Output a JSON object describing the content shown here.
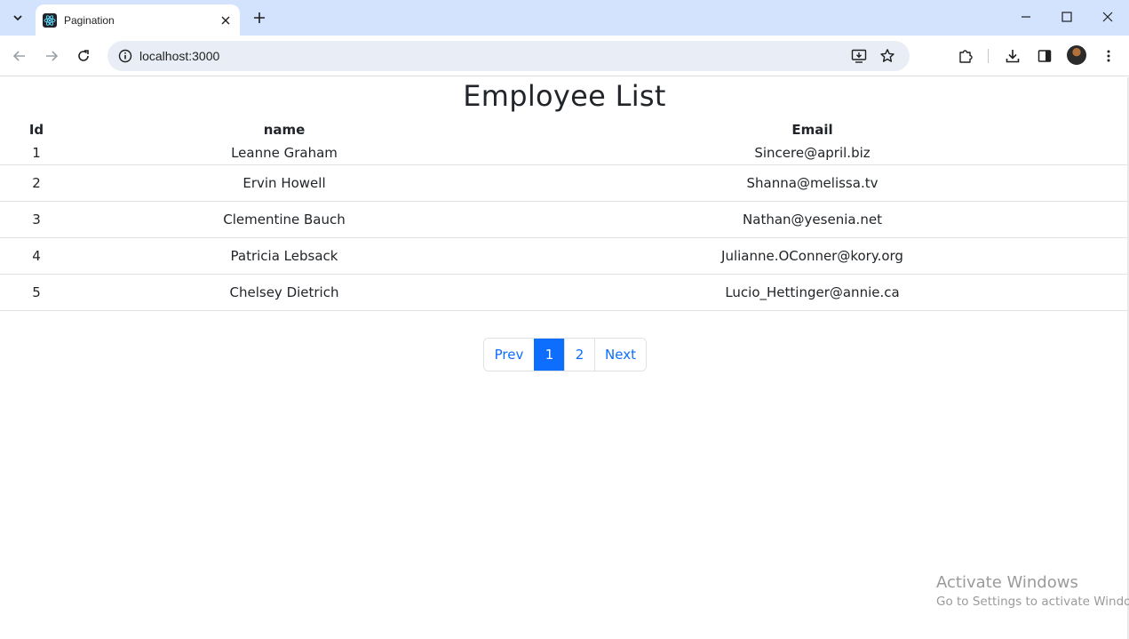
{
  "browser": {
    "tab_title": "Pagination",
    "url": "localhost:3000"
  },
  "page": {
    "title": "Employee List",
    "columns": [
      "Id",
      "name",
      "Email"
    ],
    "rows": [
      {
        "id": "1",
        "name": "Leanne Graham",
        "email": "Sincere@april.biz"
      },
      {
        "id": "2",
        "name": "Ervin Howell",
        "email": "Shanna@melissa.tv"
      },
      {
        "id": "3",
        "name": "Clementine Bauch",
        "email": "Nathan@yesenia.net"
      },
      {
        "id": "4",
        "name": "Patricia Lebsack",
        "email": "Julianne.OConner@kory.org"
      },
      {
        "id": "5",
        "name": "Chelsey Dietrich",
        "email": "Lucio_Hettinger@annie.ca"
      }
    ],
    "pagination": {
      "prev_label": "Prev",
      "pages": [
        "1",
        "2"
      ],
      "active_page": "1",
      "next_label": "Next"
    }
  },
  "watermark": {
    "title": "Activate Windows",
    "subtitle": "Go to Settings to activate Windo"
  },
  "colors": {
    "tabstrip": "#d3e3fd",
    "accent": "#0d6efd",
    "text": "#212529"
  },
  "icons": {
    "tab_search": "chevron-down-icon",
    "favicon": "react-icon",
    "tab_close": "close-icon",
    "new_tab": "plus-icon",
    "back": "back-arrow-icon",
    "forward": "forward-arrow-icon",
    "reload": "reload-icon",
    "site_info": "site-info-icon",
    "install": "install-app-icon",
    "bookmark": "star-icon",
    "extensions": "puzzle-icon",
    "downloads": "download-icon",
    "side_panel": "side-panel-icon",
    "menu": "kebab-menu-icon"
  }
}
